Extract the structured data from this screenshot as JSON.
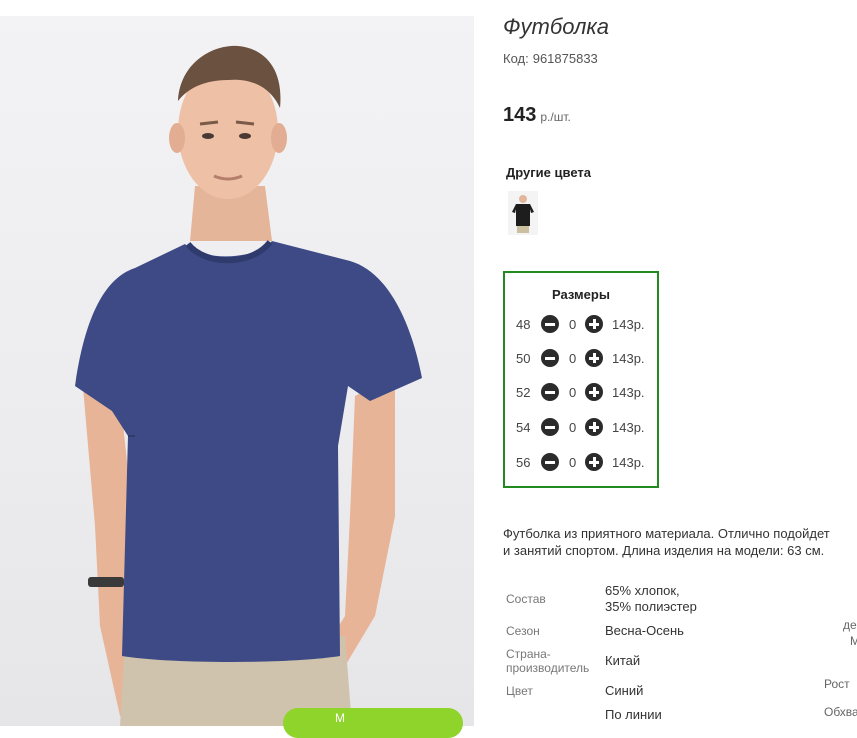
{
  "product": {
    "title": "Футболка",
    "code_label": "Код:",
    "code_value": "961875833",
    "price": "143",
    "price_unit": "р./шт."
  },
  "other_colors": {
    "label": "Другие цвета",
    "thumbnail_icon": "black-tshirt-thumbnail"
  },
  "sizes": {
    "title": "Размеры",
    "rows": [
      {
        "size": "48",
        "qty": "0",
        "price": "143р."
      },
      {
        "size": "50",
        "qty": "0",
        "price": "143р."
      },
      {
        "size": "52",
        "qty": "0",
        "price": "143р."
      },
      {
        "size": "54",
        "qty": "0",
        "price": "143р."
      },
      {
        "size": "56",
        "qty": "0",
        "price": "143р."
      }
    ],
    "border_color": "#218a21"
  },
  "description": {
    "line1": "Футболка из приятного материала. Отлично подойдет",
    "line2": "и занятий спортом. Длина изделия на модели: 63 см."
  },
  "attributes": {
    "composition_label": "Состав",
    "composition_value_1": "65% хлопок,",
    "composition_value_2": "35% полиэстер",
    "season_label": "Сезон",
    "season_value": "Весна-Осень",
    "country_label_1": "Страна-",
    "country_label_2": "производитель",
    "country_value": "Китай",
    "color_label": "Цвет",
    "color_value": "Синий",
    "last_value": "По линии"
  },
  "side_column": {
    "item1": "де",
    "item2": "М",
    "item3": "Рост",
    "item4": "Обхва"
  },
  "cart_button": {
    "label": "М",
    "color": "#8fd42a"
  },
  "shirt_color": "#3d4a85"
}
